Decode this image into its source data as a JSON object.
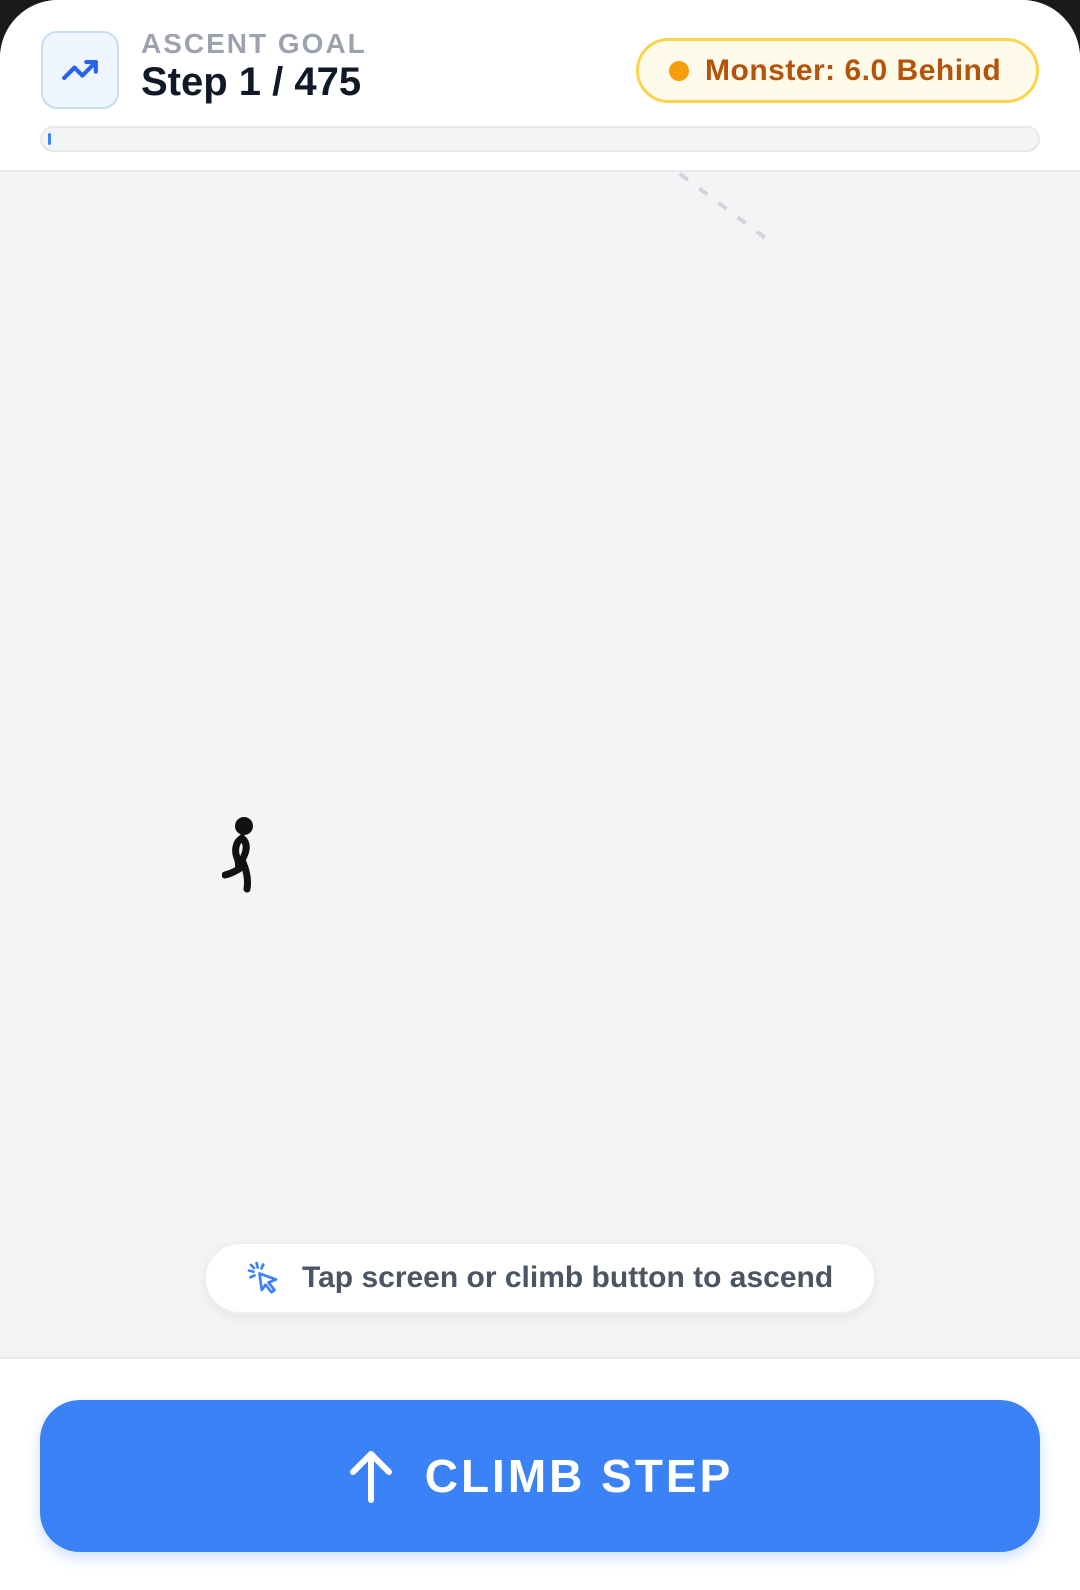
{
  "header": {
    "goal_icon": "trending-up-icon",
    "goal_label": "ASCENT GOAL",
    "step_text": "Step 1 / 475",
    "current_step": 1,
    "total_steps": 475,
    "progress_fraction": 0.002,
    "monster_status": "Monster: 6.0 Behind"
  },
  "play_area": {
    "climber_icon": "walking-person-icon",
    "hint_icon": "tap-cursor-icon",
    "hint_text": "Tap screen or climb button to ascend"
  },
  "footer": {
    "climb_icon": "arrow-up-icon",
    "climb_label": "CLIMB STEP"
  },
  "colors": {
    "accent": "#3b82f6",
    "monster_dot": "#f59e0b",
    "monster_text": "#b45309",
    "monster_bg": "#fffbeb",
    "background": "#f3f4f6"
  }
}
